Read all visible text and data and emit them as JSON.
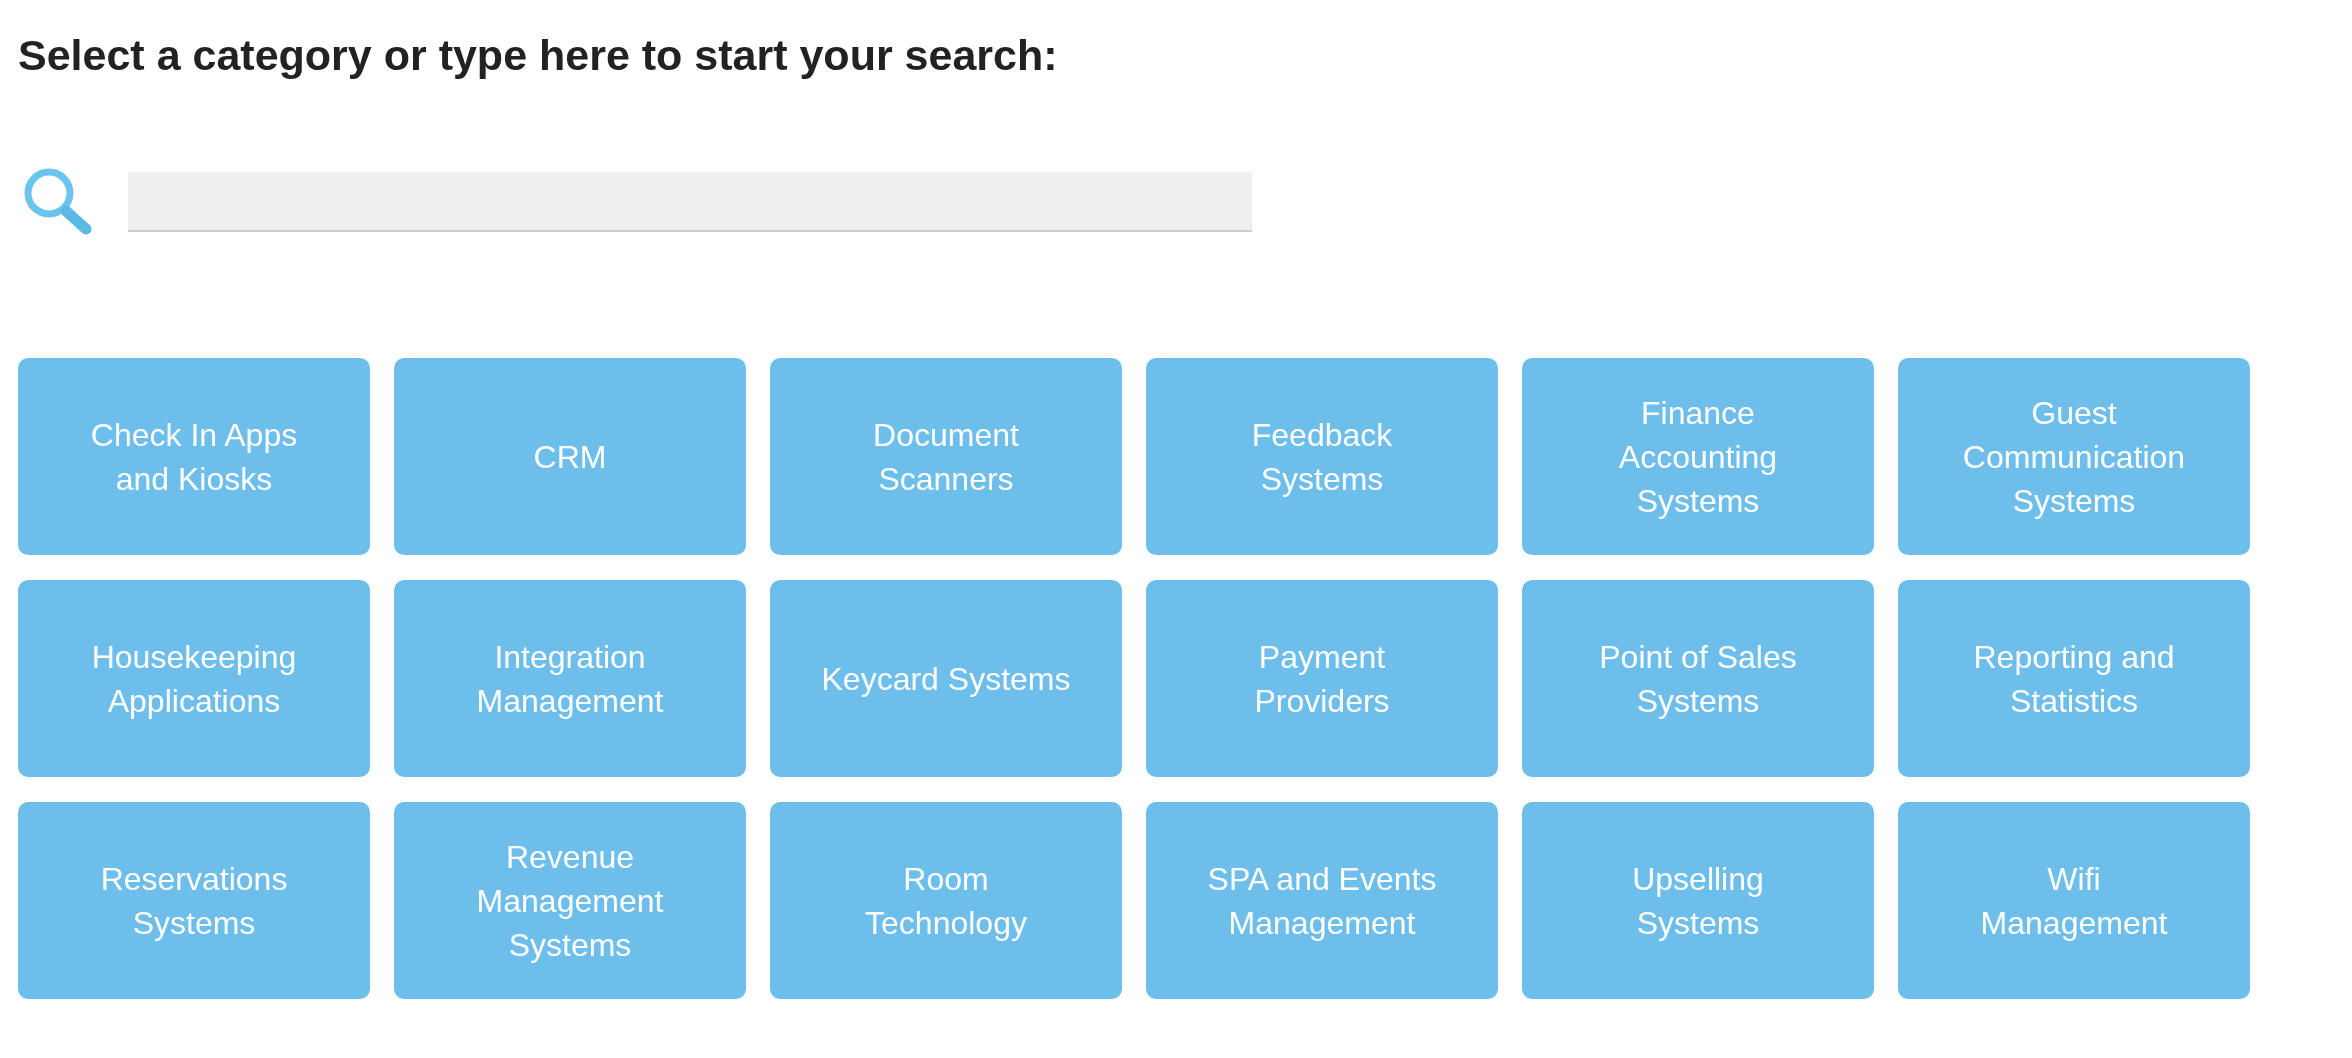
{
  "heading": "Select a category or type here to start your search:",
  "categories": [
    {
      "label": "Check In Apps\nand Kiosks"
    },
    {
      "label": "CRM"
    },
    {
      "label": "Document\nScanners"
    },
    {
      "label": "Feedback\nSystems"
    },
    {
      "label": "Finance\nAccounting\nSystems"
    },
    {
      "label": "Guest\nCommunication\nSystems"
    },
    {
      "label": "Housekeeping\nApplications"
    },
    {
      "label": "Integration\nManagement"
    },
    {
      "label": "Keycard Systems"
    },
    {
      "label": "Payment\nProviders"
    },
    {
      "label": "Point of Sales\nSystems"
    },
    {
      "label": "Reporting and\nStatistics"
    },
    {
      "label": "Reservations\nSystems"
    },
    {
      "label": "Revenue\nManagement\nSystems"
    },
    {
      "label": "Room\nTechnology"
    },
    {
      "label": "SPA and Events\nManagement"
    },
    {
      "label": "Upselling\nSystems"
    },
    {
      "label": "Wifi\nManagement"
    }
  ]
}
